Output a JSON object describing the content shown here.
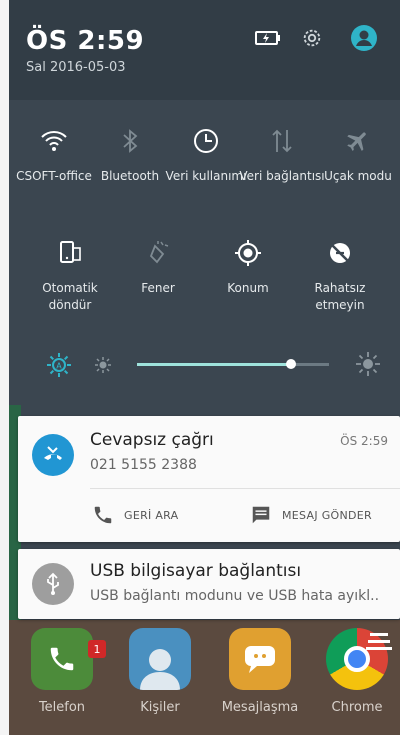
{
  "status_header": {
    "time": "ÖS 2:59",
    "date": "Sal 2016-05-03",
    "icons": [
      "battery-charging-icon",
      "settings-gear-icon",
      "account-icon"
    ]
  },
  "quick_settings": {
    "row1": [
      {
        "label": "CSOFT-office",
        "icon": "wifi-icon",
        "active": true
      },
      {
        "label": "Bluetooth",
        "icon": "bluetooth-icon",
        "active": false
      },
      {
        "label": "Veri kullanımı",
        "icon": "data-usage-icon",
        "active": true
      },
      {
        "label": "Veri bağlantısı",
        "icon": "mobile-data-icon",
        "active": false
      },
      {
        "label": "Uçak modu",
        "icon": "airplane-icon",
        "active": false
      }
    ],
    "row2": [
      {
        "label": "Otomatik döndür",
        "icon": "auto-rotate-icon",
        "active": true
      },
      {
        "label": "Fener",
        "icon": "flashlight-icon",
        "active": false
      },
      {
        "label": "Konum",
        "icon": "location-icon",
        "active": true
      },
      {
        "label": "Rahatsız etmeyin",
        "icon": "do-not-disturb-icon",
        "active": true
      }
    ],
    "brightness": {
      "auto": true,
      "level": 0.8,
      "icons": [
        "auto-brightness-icon",
        "brightness-low-icon",
        "brightness-high-icon"
      ]
    }
  },
  "notifications": {
    "missed_call": {
      "title": "Cevapsız çağrı",
      "number": "021 5155 2388",
      "time": "ÖS 2:59",
      "action_callback": "GERİ ARA",
      "action_message": "MESAJ GÖNDER",
      "accent": "#2196d3"
    },
    "usb": {
      "title": "USB bilgisayar bağlantısı",
      "text": "USB bağlantı modunu ve USB hata ayıkl..",
      "accent": "#9e9e9e"
    }
  },
  "dock": {
    "apps": [
      {
        "label": "Telefon",
        "icon": "phone-app-icon",
        "badge": "1"
      },
      {
        "label": "Kişiler",
        "icon": "contacts-app-icon"
      },
      {
        "label": "Mesajlaşma",
        "icon": "messaging-app-icon"
      },
      {
        "label": "Chrome",
        "icon": "chrome-app-icon"
      }
    ]
  },
  "colors": {
    "panel": "#3b4650",
    "header": "#323d46",
    "accent_teal": "#2fb4c8",
    "slider_fill": "#9fe3dc"
  }
}
